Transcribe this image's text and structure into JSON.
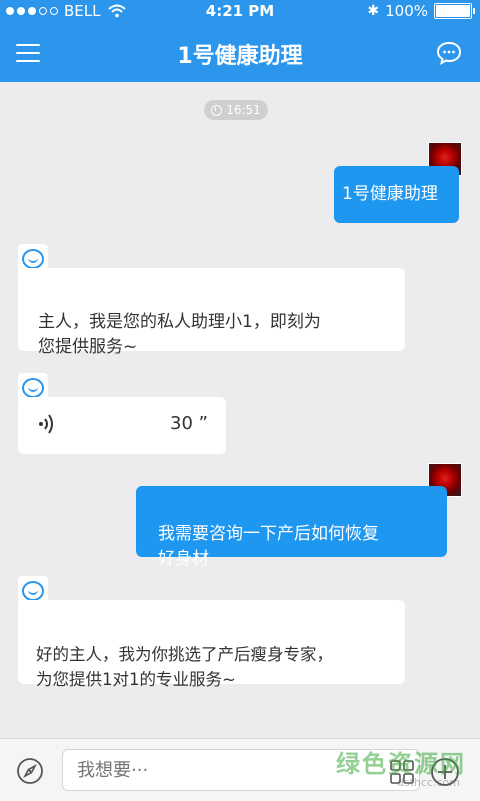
{
  "status_bar": {
    "carrier": "BELL",
    "time": "4:21 PM",
    "battery": "100%",
    "battery_level": 1.0
  },
  "header": {
    "title": "1号健康助理",
    "menu_icon": "hamburger-menu-icon",
    "chat_icon": "speech-bubble-icon"
  },
  "chat": {
    "timestamp": "16:51",
    "messages": [
      {
        "side": "right",
        "text": "1号健康助理"
      },
      {
        "side": "left",
        "text": "主人，我是您的私人助理小1，即刻为\n您提供服务~"
      },
      {
        "side": "left",
        "type": "voice",
        "duration": "30 ”"
      },
      {
        "side": "right",
        "text": "我需要咨询一下产后如何恢复\n好身材"
      },
      {
        "side": "left",
        "text": "好的主人，我为你挑选了产后瘦身专家，\n为您提供1对1的专业服务~"
      }
    ]
  },
  "composer": {
    "placeholder": "我想要···",
    "left_icon": "compass-icon",
    "grid_icon": "grid-icon",
    "add_icon": "plus-circle-icon"
  },
  "watermark": {
    "text": "绿色资源网",
    "sub": "dsthcc.com"
  },
  "colors": {
    "brand": "#2b96ec",
    "bubble_right": "#1e97f0",
    "background": "#ececee"
  }
}
